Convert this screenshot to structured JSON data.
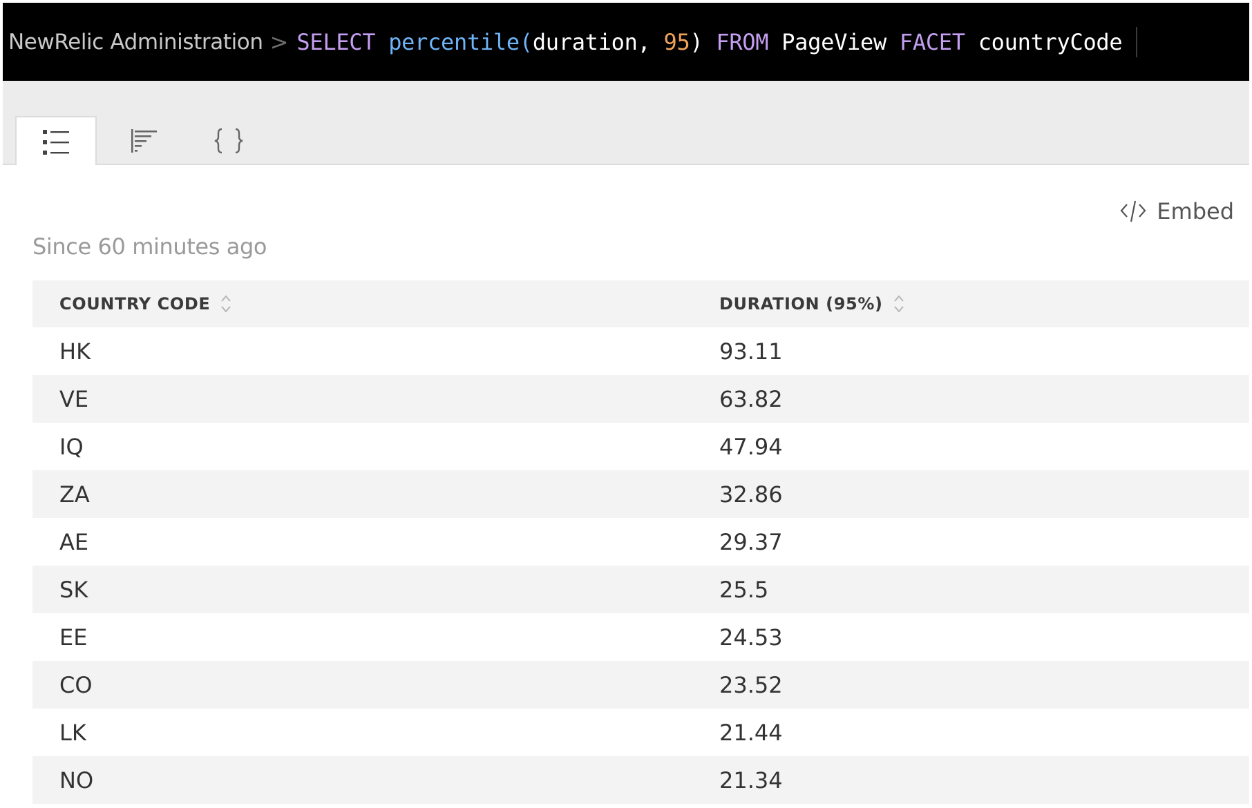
{
  "header": {
    "breadcrumb": "NewRelic Administration",
    "breadcrumb_separator": ">",
    "query": {
      "select_kw": "SELECT",
      "function_name": "percentile(",
      "args_prefix": "duration, ",
      "args_number": "95",
      "args_close": ")",
      "from_kw": "FROM",
      "event_type": "PageView",
      "facet_kw": "FACET",
      "facet_attr": "countryCode"
    }
  },
  "tabs": [
    {
      "icon": "list-view-icon",
      "active": true
    },
    {
      "icon": "bar-chart-icon",
      "active": false
    },
    {
      "icon": "json-braces-icon",
      "active": false
    }
  ],
  "embed": {
    "label": "Embed",
    "icon": "code-embed-icon"
  },
  "time_range": "Since 60 minutes ago",
  "table": {
    "columns": [
      "COUNTRY CODE",
      "DURATION (95%)"
    ],
    "rows": [
      {
        "code": "HK",
        "duration": "93.11"
      },
      {
        "code": "VE",
        "duration": "63.82"
      },
      {
        "code": "IQ",
        "duration": "47.94"
      },
      {
        "code": "ZA",
        "duration": "32.86"
      },
      {
        "code": "AE",
        "duration": "29.37"
      },
      {
        "code": "SK",
        "duration": "25.5"
      },
      {
        "code": "EE",
        "duration": "24.53"
      },
      {
        "code": "CO",
        "duration": "23.52"
      },
      {
        "code": "LK",
        "duration": "21.44"
      },
      {
        "code": "NO",
        "duration": "21.34"
      }
    ]
  },
  "colors": {
    "keyword": "#c49ef0",
    "function": "#6eb4f7",
    "number": "#f0a35a",
    "query_bg": "#000000",
    "stripe": "#f3f3f3"
  }
}
